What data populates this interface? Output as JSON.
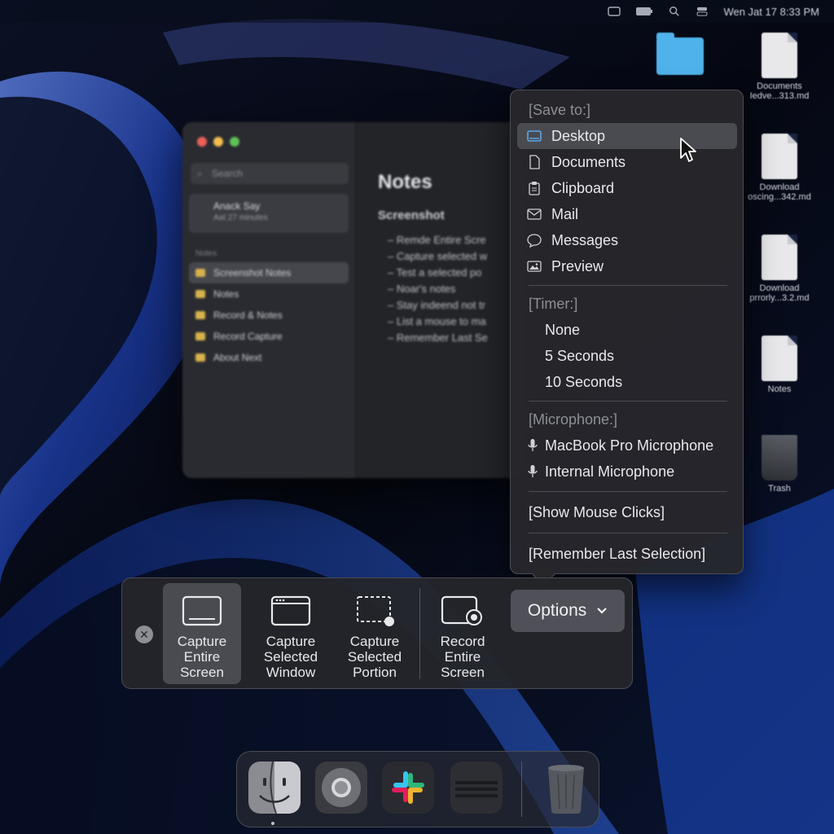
{
  "menubar": {
    "clock": "Wen Jat 17 8:33 PM"
  },
  "desktop": {
    "icons": [
      {
        "label": "",
        "icon": "folder-icon"
      },
      {
        "label": "Documents Iedve...313.md",
        "icon": "document-icon"
      },
      {
        "label": "Download oscing...342.md",
        "icon": "document-icon"
      },
      {
        "label": "Download prrorly...3.2.md",
        "icon": "document-icon"
      },
      {
        "label": "Notes",
        "icon": "document-icon"
      },
      {
        "label": "Trash",
        "icon": "trash-icon"
      }
    ]
  },
  "notes_window": {
    "search_placeholder": "Search",
    "account_name": "Anack Say",
    "account_sub": "Aat 27 minutes",
    "section_label": "Notes",
    "sidebar_items": [
      "Screenshot Notes",
      "Notes",
      "Record & Notes",
      "Record Capture",
      "About Next"
    ],
    "title": "Notes",
    "subtitle": "Screenshot",
    "lines": [
      "Remde Entire Scre",
      "Capture selected w",
      "Test a selected po",
      "Noar's notes",
      "Stay indeend not tr",
      "List a mouse to ma",
      "Remember Last Se"
    ]
  },
  "options_menu": {
    "save_header": "[Save to:]",
    "save_items": [
      {
        "label": "Desktop",
        "icon": "desktop-icon",
        "selected": true
      },
      {
        "label": "Documents",
        "icon": "document-icon",
        "selected": false
      },
      {
        "label": "Clipboard",
        "icon": "clipboard-icon",
        "selected": false
      },
      {
        "label": "Mail",
        "icon": "mail-icon",
        "selected": false
      },
      {
        "label": "Messages",
        "icon": "messages-icon",
        "selected": false
      },
      {
        "label": "Preview",
        "icon": "preview-icon",
        "selected": false
      }
    ],
    "timer_header": "[Timer:]",
    "timer_items": [
      "None",
      "5 Seconds",
      "10 Seconds"
    ],
    "microphone_header": "[Microphone:]",
    "microphone_items": [
      "MacBook Pro Microphone",
      "Internal Microphone"
    ],
    "show_mouse_clicks": "[Show Mouse Clicks]",
    "remember_last_selection": "[Remember Last Selection]"
  },
  "toolbar": {
    "tools": [
      {
        "line1": "Capture",
        "line2": "Entire",
        "line3": "Screen",
        "active": true
      },
      {
        "line1": "Capture",
        "line2": "Selected",
        "line3": "Window",
        "active": false
      },
      {
        "line1": "Capture",
        "line2": "Selected",
        "line3": "Portion",
        "active": false
      },
      {
        "line1": "Record",
        "line2": "Entire",
        "line3": "Screen",
        "active": false
      }
    ],
    "options_label": "Options"
  },
  "dock": {
    "apps": [
      "finder-icon",
      "chrome-icon",
      "slack-icon",
      "app-icon",
      "trash-icon"
    ]
  },
  "colors": {
    "menu_bg": "#26272c",
    "selected_bg": "#4a4b51",
    "desktop_accent": "#4fb2ea"
  }
}
